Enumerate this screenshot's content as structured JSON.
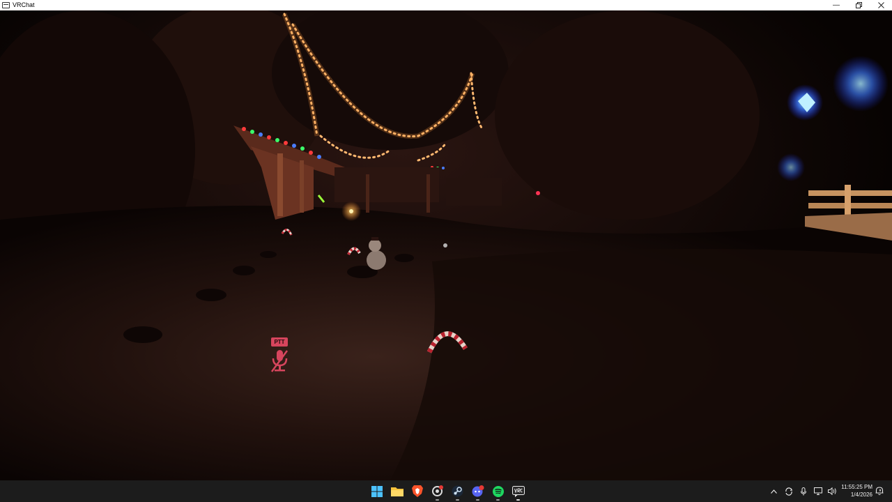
{
  "window": {
    "title": "VRChat",
    "app_icon": "vrchat-window-icon",
    "controls": [
      "minimize-icon",
      "restore-icon",
      "close-icon"
    ]
  },
  "hud": {
    "ptt_label": "PTT",
    "mic_icon": "microphone-muted-icon"
  },
  "taskbar": {
    "apps": [
      {
        "name": "start",
        "icon": "windows-start-icon"
      },
      {
        "name": "file-explorer",
        "icon": "folder-icon"
      },
      {
        "name": "brave",
        "icon": "brave-lion-icon"
      },
      {
        "name": "app-ring",
        "icon": "ring-app-icon"
      },
      {
        "name": "steam",
        "icon": "steam-icon"
      },
      {
        "name": "discord",
        "icon": "discord-icon"
      },
      {
        "name": "spotify",
        "icon": "spotify-icon"
      },
      {
        "name": "vrchat",
        "icon": "vrchat-icon"
      }
    ],
    "tray": [
      "chevron-up-icon",
      "sync-icon",
      "microphone-icon",
      "display-icon",
      "volume-icon"
    ],
    "time": "11:55:25 PM",
    "date": "1/4/2026"
  }
}
